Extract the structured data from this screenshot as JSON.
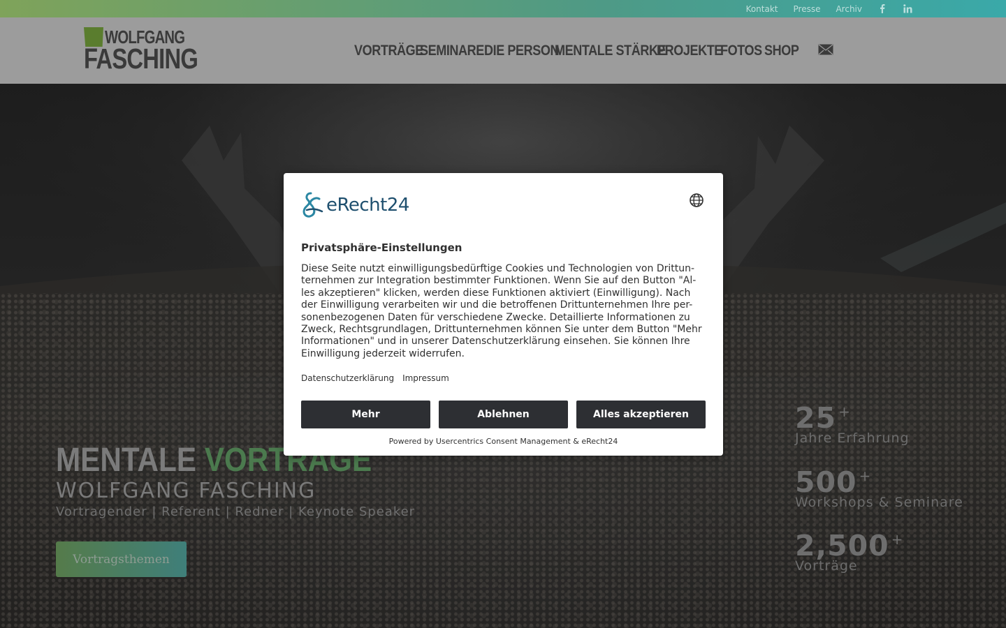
{
  "topbar": {
    "links": [
      "Kontakt",
      "Presse",
      "Archiv"
    ],
    "social_icons": [
      "facebook-icon",
      "linkedin-icon"
    ]
  },
  "header": {
    "logo": {
      "line1": "WOLFGANG",
      "line2": "FASCHING"
    },
    "nav": [
      "VORTRÄGE",
      "SEMINARE",
      "DIE PERSON",
      "MENTALE STÄRKE",
      "PROJEKTE",
      "FOTOS",
      "SHOP"
    ],
    "mail_icon": "mail-icon"
  },
  "hero": {
    "title_part1": "MENTALE",
    "title_part2": "VORTRÄGE",
    "subtitle": "WOLFGANG FASCHING",
    "roles": "Vortragender | Referent | Redner | Keynote Speaker",
    "button": "Vortragsthemen",
    "stats": [
      {
        "value": "25",
        "suffix": "+",
        "label": "Jahre Erfahrung"
      },
      {
        "value": "500",
        "suffix": "+",
        "label": "Workshops & Seminare"
      },
      {
        "value": "2,500",
        "suffix": "+",
        "label": "Vorträge"
      }
    ]
  },
  "consent": {
    "brand": "eRecht24",
    "language_icon": "globe-icon",
    "title": "Privatsphäre-Einstellungen",
    "description": "Diese Seite nutzt einwilligungsbedürftige Cookies und Technologien von Drittun-ternehmen zur Integration bestimmter Funktionen. Wenn Sie auf den Button \"Al-les akzeptieren\" klicken, werden diese Funktionen aktiviert (Einwilligung). Nach der Einwilligung verarbeiten wir und die betroffenen Drittunternehmen Ihre per-sonenbezogenen Daten für verschiedene Zwecke. Detaillierte Informationen zu Zweck, Rechtsgrundlagen, Drittunternehmen können Sie unter dem Button \"Mehr Informationen\" und in unserer Datenschutzerklärung einsehen. Sie können Ihre Einwilligung jederzeit widerrufen.",
    "links": [
      "Datenschutzerklärung",
      "Impressum"
    ],
    "buttons": {
      "more": "Mehr",
      "decline": "Ablehnen",
      "accept": "Alles akzeptieren"
    },
    "powered_by": "Powered by Usercentrics Consent Management & eRecht24"
  },
  "colors": {
    "topbar_start": "#7fa35a",
    "topbar_end": "#3aa9a9",
    "accent_green": "#4b7a4e",
    "button_dark": "#2d2f33",
    "brand_blue": "#1e4f6e"
  }
}
